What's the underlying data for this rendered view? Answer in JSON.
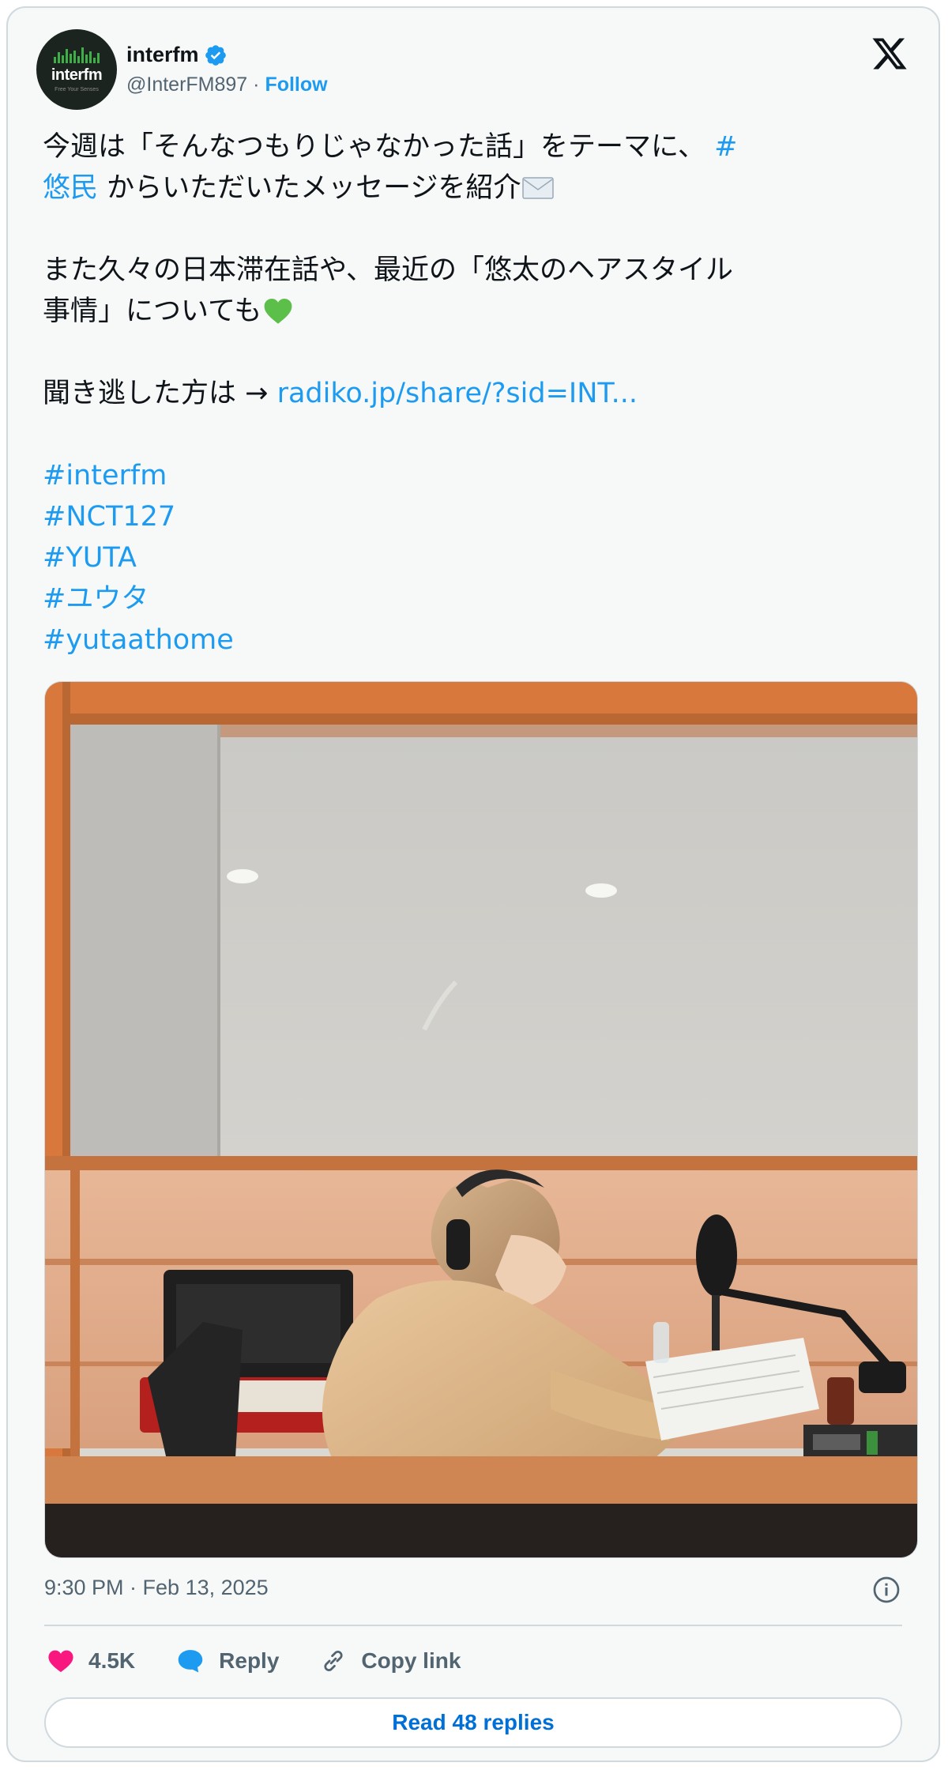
{
  "account": {
    "name": "interfm",
    "handle": "@InterFM897",
    "separator": " · ",
    "follow_label": "Follow",
    "avatar_text": "interfm",
    "avatar_subtext": "Free Your Senses",
    "verified": true
  },
  "icons": {
    "brand": "x-logo-icon",
    "verified": "verified-badge-icon",
    "info": "info-icon",
    "like": "heart-icon",
    "reply": "speech-bubble-icon",
    "copy": "link-icon",
    "envelope": "envelope-emoji",
    "heart_emoji": "green-heart-emoji"
  },
  "tweet": {
    "line1_text": "今週は「そんなつもりじゃなかった話」をテーマに、",
    "line1_hashtag": "#",
    "line2_hashtag": "悠民",
    "line2_text": " からいただいたメッセージを紹介",
    "para2_line1": "また久々の日本滞在話や、最近の「悠太のヘアスタイル",
    "para2_line2": "事情」についても",
    "para3_text": "聞き逃した方は → ",
    "para3_link": "radiko.jp/share/?sid=INT...",
    "hashtags": [
      "#interfm",
      "#NCT127",
      "#YUTA",
      "#ユウタ",
      "#yutaathome"
    ]
  },
  "timestamp": "9:30 PM · Feb 13, 2025",
  "actions": {
    "likes": "4.5K",
    "reply_label": "Reply",
    "copy_label": "Copy link"
  },
  "read_replies_label": "Read 48 replies",
  "colors": {
    "link": "#1d9bf0",
    "like": "#f91880",
    "card_bg": "#f7f9f9",
    "border": "#cfd9de"
  }
}
